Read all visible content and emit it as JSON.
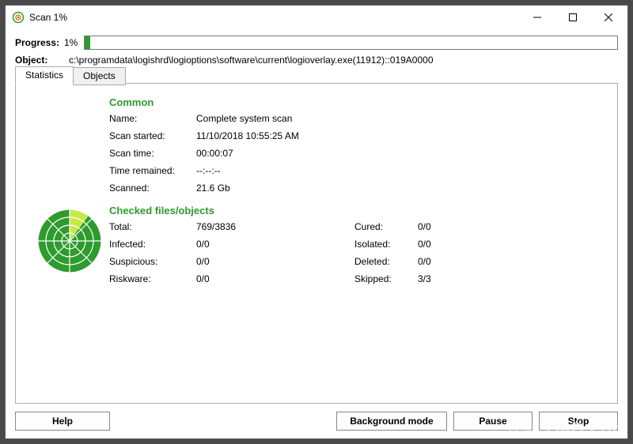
{
  "window": {
    "title": "Scan 1%"
  },
  "progress": {
    "label": "Progress:",
    "text": "1%",
    "percent": 1
  },
  "object": {
    "label": "Object:",
    "path": "c:\\programdata\\logishrd\\logioptions\\software\\current\\logioverlay.exe(11912)::019A0000"
  },
  "tabs": {
    "stats": "Statistics",
    "objects": "Objects"
  },
  "common": {
    "heading": "Common",
    "name_label": "Name:",
    "name_value": "Complete system scan",
    "started_label": "Scan started:",
    "started_value": "11/10/2018 10:55:25 AM",
    "time_label": "Scan time:",
    "time_value": "00:00:07",
    "remain_label": "Time remained:",
    "remain_value": "--:--:--",
    "scanned_label": "Scanned:",
    "scanned_value": "21.6 Gb"
  },
  "checked": {
    "heading": "Checked files/objects",
    "total_label": "Total:",
    "total_value": "769/3836",
    "infected_label": "Infected:",
    "infected_value": "0/0",
    "suspicious_label": "Suspicious:",
    "suspicious_value": "0/0",
    "riskware_label": "Riskware:",
    "riskware_value": "0/0",
    "cured_label": "Cured:",
    "cured_value": "0/0",
    "isolated_label": "Isolated:",
    "isolated_value": "0/0",
    "deleted_label": "Deleted:",
    "deleted_value": "0/0",
    "skipped_label": "Skipped:",
    "skipped_value": "3/3"
  },
  "buttons": {
    "help": "Help",
    "background": "Background mode",
    "pause": "Pause",
    "stop": "Stop"
  },
  "watermark": "LO4D.com"
}
